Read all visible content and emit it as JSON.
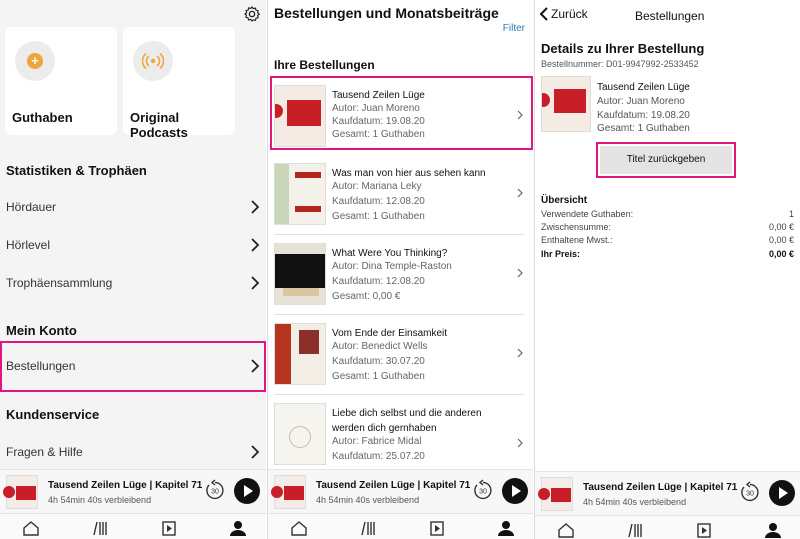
{
  "colors": {
    "accent": "#e0177f",
    "link": "#2a7fb8",
    "highlight": "#e0177f",
    "book_red": "#c81e28"
  },
  "profile": {
    "tiles": [
      {
        "label": "Guthaben",
        "icon": "plus-icon"
      },
      {
        "label": "Original Podcasts",
        "icon": "podcast-icon"
      }
    ],
    "stats_heading": "Statistiken & Trophäen",
    "stats_items": [
      "Hördauer",
      "Hörlevel",
      "Trophäensammlung"
    ],
    "account_heading": "Mein Konto",
    "account_items": [
      "Bestellungen"
    ],
    "service_heading": "Kundenservice",
    "service_items": [
      "Fragen & Hilfe"
    ]
  },
  "orders": {
    "title": "Bestellungen und Monatsbeiträge",
    "filter": "Filter",
    "section": "Ihre Bestellungen",
    "items": [
      {
        "title": "Tausend Zeilen Lüge",
        "author": "Autor: Juan Moreno",
        "date": "Kaufdatum: 19.08.20",
        "total": "Gesamt: 1 Guthaben"
      },
      {
        "title": "Was man von hier aus sehen kann",
        "author": "Autor: Mariana Leky",
        "date": "Kaufdatum: 12.08.20",
        "total": "Gesamt: 1 Guthaben"
      },
      {
        "title": "What Were You Thinking?",
        "author": "Autor: Dina Temple-Raston",
        "date": "Kaufdatum: 12.08.20",
        "total": "Gesamt: 0,00 €"
      },
      {
        "title": "Vom Ende der Einsamkeit",
        "author": "Autor: Benedict Wells",
        "date": "Kaufdatum: 30.07.20",
        "total": "Gesamt: 1 Guthaben"
      },
      {
        "title": "Liebe dich selbst und die anderen werden dich gernhaben",
        "author": "Autor: Fabrice Midal",
        "date": "Kaufdatum: 25.07.20",
        "total": ""
      }
    ]
  },
  "detail": {
    "back": "Zurück",
    "nav_title": "Bestellungen",
    "heading": "Details zu Ihrer Bestellung",
    "order_no": "Bestellnummer: D01-9947992-2533452",
    "book_title": "Tausend Zeilen Lüge",
    "author": "Autor: Juan Moreno",
    "date": "Kaufdatum: 19.08.20",
    "total": "Gesamt: 1 Guthaben",
    "return_button": "Titel zurückgeben",
    "overview_heading": "Übersicht",
    "overview": [
      {
        "label": "Verwendete Guthaben:",
        "value": "1"
      },
      {
        "label": "Zwischensumme:",
        "value": "0,00 €"
      },
      {
        "label": "Enthaltene Mwst.:",
        "value": "0,00 €"
      },
      {
        "label": "Ihr Preis:",
        "value": "0,00 €"
      }
    ]
  },
  "player": {
    "title": "Tausend Zeilen Lüge | Kapitel 71",
    "remaining": "4h 54min 40s verbleibend",
    "skip_label": "30"
  },
  "tabs": [
    "home-icon",
    "library-icon",
    "player-icon",
    "profile-icon"
  ]
}
